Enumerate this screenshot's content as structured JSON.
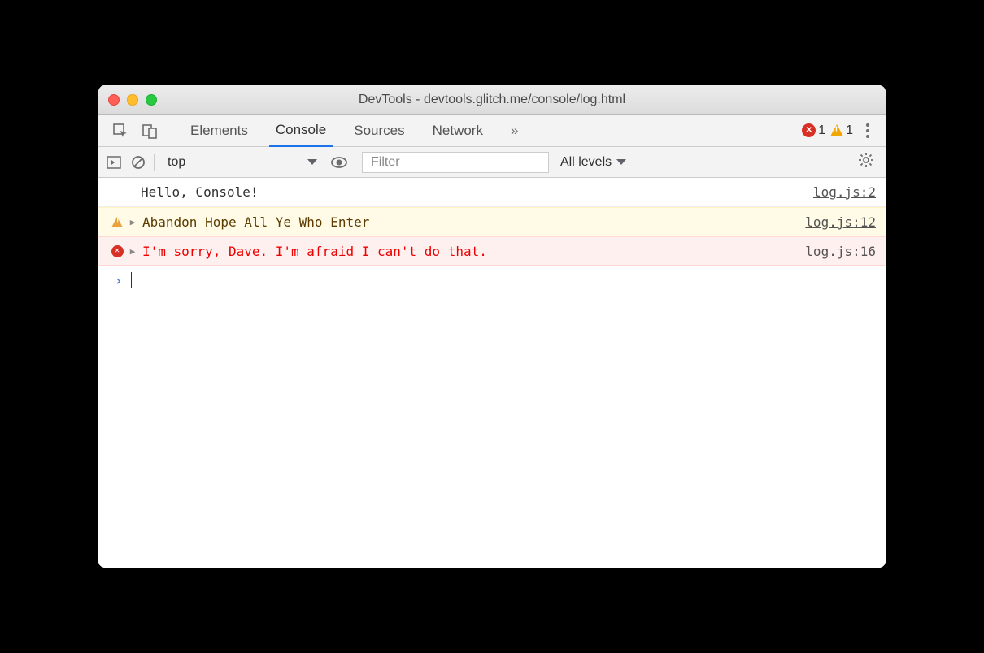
{
  "window": {
    "title": "DevTools - devtools.glitch.me/console/log.html"
  },
  "tabs": {
    "items": [
      "Elements",
      "Console",
      "Sources",
      "Network"
    ],
    "active_index": 1,
    "overflow_glyph": "»"
  },
  "status": {
    "error_count": "1",
    "warning_count": "1"
  },
  "toolbar": {
    "context": "top",
    "filter_placeholder": "Filter",
    "levels_label": "All levels"
  },
  "messages": [
    {
      "type": "log",
      "text": "Hello, Console!",
      "source": "log.js:2"
    },
    {
      "type": "warn",
      "text": "Abandon Hope All Ye Who Enter",
      "source": "log.js:12"
    },
    {
      "type": "error",
      "text": "I'm sorry, Dave. I'm afraid I can't do that.",
      "source": "log.js:16"
    }
  ],
  "prompt": {
    "caret": "›"
  }
}
